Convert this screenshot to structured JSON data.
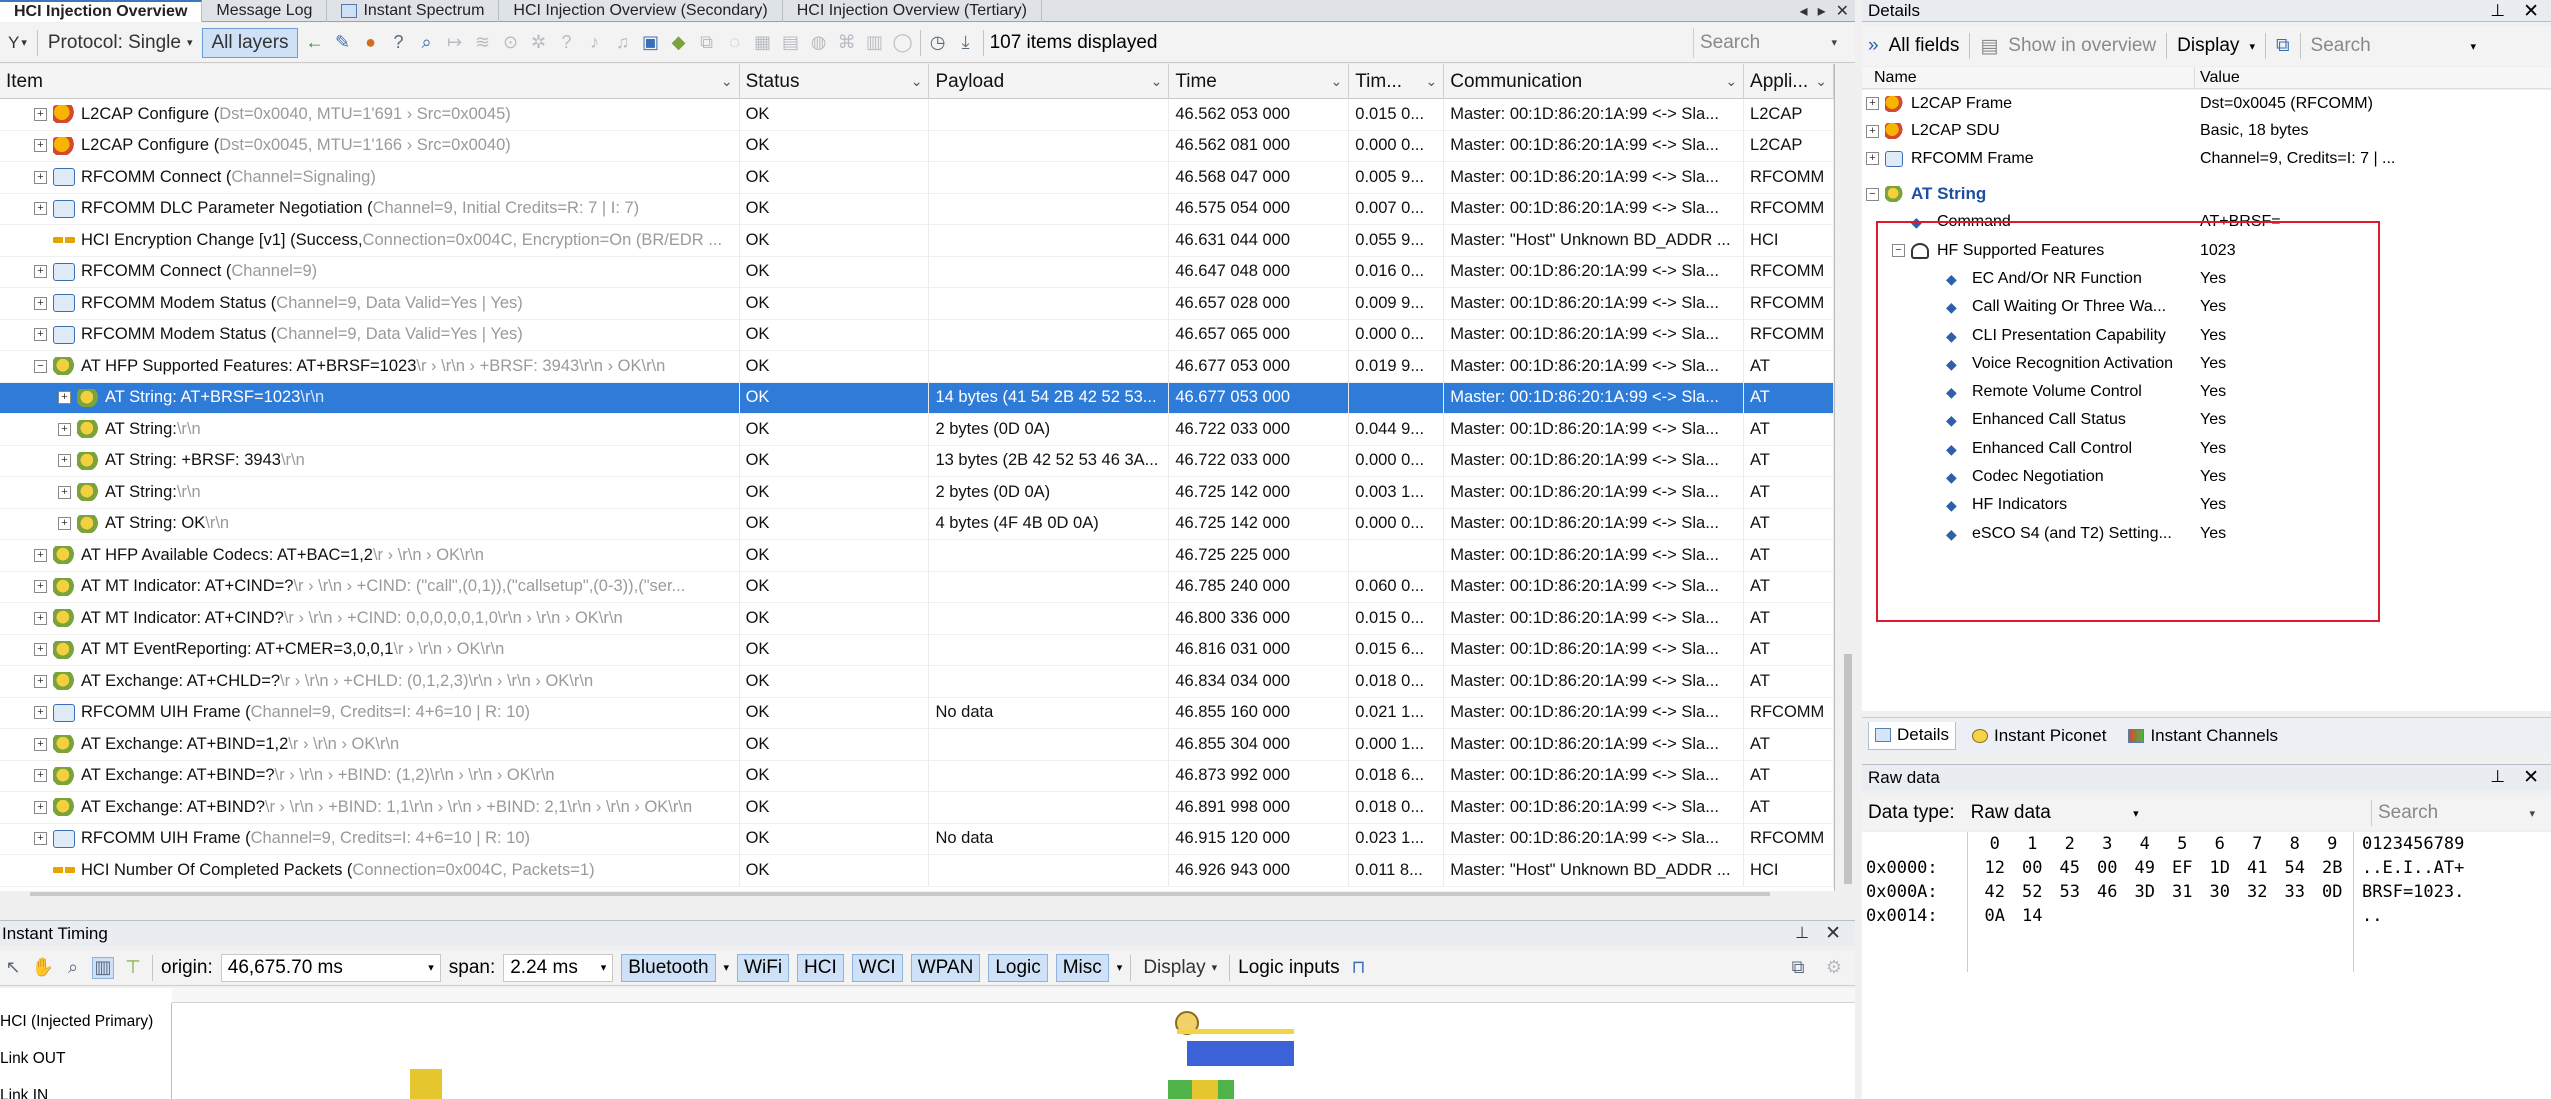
{
  "tabs": [
    {
      "label": "HCI Injection Overview",
      "active": true
    },
    {
      "label": "Message Log",
      "active": false
    },
    {
      "label": "Instant Spectrum",
      "active": false
    },
    {
      "label": "HCI Injection Overview (Secondary)",
      "active": false
    },
    {
      "label": "HCI Injection Overview (Tertiary)",
      "active": false
    }
  ],
  "toolbar": {
    "protocol_label": "Protocol: Single",
    "all_layers_label": "All layers",
    "items_count": "107 items displayed",
    "search_placeholder": "Search"
  },
  "grid": {
    "columns": [
      "Item",
      "Status",
      "Payload",
      "Time",
      "Tim...",
      "Communication",
      "Appli..."
    ],
    "rows": [
      {
        "icon": "l2cap",
        "exp": "+",
        "indent": 0,
        "item": "L2CAP Configure (",
        "params": "Dst=0x0040, MTU=1'691 › Src=0x0045",
        "tail": ")",
        "status": "OK",
        "payload": "",
        "time": "46.562 053 000",
        "delta": "0.015 0...",
        "comm": "Master: 00:1D:86:20:1A:99 <-> Sla...",
        "app": "L2CAP"
      },
      {
        "icon": "l2cap",
        "exp": "+",
        "indent": 0,
        "item": "L2CAP Configure (",
        "params": "Dst=0x0045, MTU=1'166 › Src=0x0040",
        "tail": ")",
        "status": "OK",
        "payload": "",
        "time": "46.562 081 000",
        "delta": "0.000 0...",
        "comm": "Master: 00:1D:86:20:1A:99 <-> Sla...",
        "app": "L2CAP"
      },
      {
        "icon": "rfcomm",
        "exp": "+",
        "indent": 0,
        "item": "RFCOMM Connect (",
        "params": "Channel=Signaling",
        "tail": ")",
        "status": "OK",
        "payload": "",
        "time": "46.568 047 000",
        "delta": "0.005 9...",
        "comm": "Master: 00:1D:86:20:1A:99 <-> Sla...",
        "app": "RFCOMM"
      },
      {
        "icon": "rfcomm",
        "exp": "+",
        "indent": 0,
        "item": "RFCOMM DLC Parameter Negotiation (",
        "params": "Channel=9, Initial Credits=R: 7 | I: 7",
        "tail": ")",
        "status": "OK",
        "payload": "",
        "time": "46.575 054 000",
        "delta": "0.007 0...",
        "comm": "Master: 00:1D:86:20:1A:99 <-> Sla...",
        "app": "RFCOMM"
      },
      {
        "icon": "hci",
        "exp": "",
        "indent": 0,
        "item": "HCI Encryption Change [v1] (Success, ",
        "params": "Connection=0x004C, Encryption=On (BR/EDR ...",
        "tail": "",
        "status": "OK",
        "payload": "",
        "time": "46.631 044 000",
        "delta": "0.055 9...",
        "comm": "Master: \"Host\" Unknown BD_ADDR ...",
        "app": "HCI"
      },
      {
        "icon": "rfcomm",
        "exp": "+",
        "indent": 0,
        "item": "RFCOMM Connect (",
        "params": "Channel=9",
        "tail": ")",
        "status": "OK",
        "payload": "",
        "time": "46.647 048 000",
        "delta": "0.016 0...",
        "comm": "Master: 00:1D:86:20:1A:99 <-> Sla...",
        "app": "RFCOMM"
      },
      {
        "icon": "rfcomm",
        "exp": "+",
        "indent": 0,
        "item": "RFCOMM Modem Status (",
        "params": "Channel=9, Data Valid=Yes | Yes",
        "tail": ")",
        "status": "OK",
        "payload": "",
        "time": "46.657 028 000",
        "delta": "0.009 9...",
        "comm": "Master: 00:1D:86:20:1A:99 <-> Sla...",
        "app": "RFCOMM"
      },
      {
        "icon": "rfcomm",
        "exp": "+",
        "indent": 0,
        "item": "RFCOMM Modem Status (",
        "params": "Channel=9, Data Valid=Yes | Yes",
        "tail": ")",
        "status": "OK",
        "payload": "",
        "time": "46.657 065 000",
        "delta": "0.000 0...",
        "comm": "Master: 00:1D:86:20:1A:99 <-> Sla...",
        "app": "RFCOMM"
      },
      {
        "icon": "at",
        "exp": "−",
        "indent": 0,
        "item": "AT HFP Supported Features: AT+BRSF=1023",
        "params": "\\r › \\r\\n › +BRSF: 3943",
        "tail": "\\r\\n › OK\\r\\n",
        "status": "OK",
        "payload": "",
        "time": "46.677 053 000",
        "delta": "0.019 9...",
        "comm": "Master: 00:1D:86:20:1A:99 <-> Sla...",
        "app": "AT"
      },
      {
        "icon": "at",
        "exp": "+",
        "indent": 1,
        "item": "AT String: AT+BRSF=1023",
        "params": "\\r\\n",
        "tail": "",
        "status": "OK",
        "payload": "14 bytes (41 54 2B 42 52 53...",
        "time": "46.677 053 000",
        "delta": "",
        "comm": "Master: 00:1D:86:20:1A:99 <-> Sla...",
        "app": "AT",
        "selected": true
      },
      {
        "icon": "at",
        "exp": "+",
        "indent": 1,
        "item": "AT String: ",
        "params": "\\r\\n",
        "tail": "",
        "status": "OK",
        "payload": "2 bytes (0D 0A)",
        "time": "46.722 033 000",
        "delta": "0.044 9...",
        "comm": "Master: 00:1D:86:20:1A:99 <-> Sla...",
        "app": "AT"
      },
      {
        "icon": "at",
        "exp": "+",
        "indent": 1,
        "item": "AT String: +BRSF: 3943",
        "params": "\\r\\n",
        "tail": "",
        "status": "OK",
        "payload": "13 bytes (2B 42 52 53 46 3A...",
        "time": "46.722 033 000",
        "delta": "0.000 0...",
        "comm": "Master: 00:1D:86:20:1A:99 <-> Sla...",
        "app": "AT"
      },
      {
        "icon": "at",
        "exp": "+",
        "indent": 1,
        "item": "AT String: ",
        "params": "\\r\\n",
        "tail": "",
        "status": "OK",
        "payload": "2 bytes (0D 0A)",
        "time": "46.725 142 000",
        "delta": "0.003 1...",
        "comm": "Master: 00:1D:86:20:1A:99 <-> Sla...",
        "app": "AT"
      },
      {
        "icon": "at",
        "exp": "+",
        "indent": 1,
        "item": "AT String: OK",
        "params": "\\r\\n",
        "tail": "",
        "status": "OK",
        "payload": "4 bytes (4F 4B 0D 0A)",
        "time": "46.725 142 000",
        "delta": "0.000 0...",
        "comm": "Master: 00:1D:86:20:1A:99 <-> Sla...",
        "app": "AT"
      },
      {
        "icon": "at",
        "exp": "+",
        "indent": 0,
        "item": "AT HFP Available Codecs: AT+BAC=1,2",
        "params": "\\r › \\r\\n › OK\\r\\n",
        "tail": "",
        "status": "OK",
        "payload": "",
        "time": "46.725 225 000",
        "delta": "",
        "comm": "Master: 00:1D:86:20:1A:99 <-> Sla...",
        "app": "AT"
      },
      {
        "icon": "at",
        "exp": "+",
        "indent": 0,
        "item": "AT MT Indicator: AT+CIND=?",
        "params": "\\r › \\r\\n › +CIND: (\"call\",(0,1)),(\"callsetup\",(0-3)),(\"ser...",
        "tail": "",
        "status": "OK",
        "payload": "",
        "time": "46.785 240 000",
        "delta": "0.060 0...",
        "comm": "Master: 00:1D:86:20:1A:99 <-> Sla...",
        "app": "AT"
      },
      {
        "icon": "at",
        "exp": "+",
        "indent": 0,
        "item": "AT MT Indicator: AT+CIND?",
        "params": "\\r › \\r\\n › +CIND: 0,0,0,0,0,1,0\\r\\n › \\r\\n › OK\\r\\n",
        "tail": "",
        "status": "OK",
        "payload": "",
        "time": "46.800 336 000",
        "delta": "0.015 0...",
        "comm": "Master: 00:1D:86:20:1A:99 <-> Sla...",
        "app": "AT"
      },
      {
        "icon": "at",
        "exp": "+",
        "indent": 0,
        "item": "AT MT EventReporting: AT+CMER=3,0,0,1",
        "params": "\\r › \\r\\n › OK\\r\\n",
        "tail": "",
        "status": "OK",
        "payload": "",
        "time": "46.816 031 000",
        "delta": "0.015 6...",
        "comm": "Master: 00:1D:86:20:1A:99 <-> Sla...",
        "app": "AT"
      },
      {
        "icon": "at",
        "exp": "+",
        "indent": 0,
        "item": "AT Exchange: AT+CHLD=?",
        "params": "\\r › \\r\\n › +CHLD: (0,1,2,3)\\r\\n › \\r\\n › OK\\r\\n",
        "tail": "",
        "status": "OK",
        "payload": "",
        "time": "46.834 034 000",
        "delta": "0.018 0...",
        "comm": "Master: 00:1D:86:20:1A:99 <-> Sla...",
        "app": "AT"
      },
      {
        "icon": "rfcomm",
        "exp": "+",
        "indent": 0,
        "item": "RFCOMM UIH Frame (",
        "params": "Channel=9, Credits=I: 4+6=10 | R: 10",
        "tail": ")",
        "status": "OK",
        "payload": "No data",
        "time": "46.855 160 000",
        "delta": "0.021 1...",
        "comm": "Master: 00:1D:86:20:1A:99 <-> Sla...",
        "app": "RFCOMM"
      },
      {
        "icon": "at",
        "exp": "+",
        "indent": 0,
        "item": "AT Exchange: AT+BIND=1,2",
        "params": "\\r › \\r\\n › OK\\r\\n",
        "tail": "",
        "status": "OK",
        "payload": "",
        "time": "46.855 304 000",
        "delta": "0.000 1...",
        "comm": "Master: 00:1D:86:20:1A:99 <-> Sla...",
        "app": "AT"
      },
      {
        "icon": "at",
        "exp": "+",
        "indent": 0,
        "item": "AT Exchange: AT+BIND=?",
        "params": "\\r › \\r\\n › +BIND: (1,2)\\r\\n › \\r\\n › OK\\r\\n",
        "tail": "",
        "status": "OK",
        "payload": "",
        "time": "46.873 992 000",
        "delta": "0.018 6...",
        "comm": "Master: 00:1D:86:20:1A:99 <-> Sla...",
        "app": "AT"
      },
      {
        "icon": "at",
        "exp": "+",
        "indent": 0,
        "item": "AT Exchange: AT+BIND?",
        "params": "\\r › \\r\\n › +BIND: 1,1\\r\\n › \\r\\n › +BIND: 2,1\\r\\n › \\r\\n › OK\\r\\n",
        "tail": "",
        "status": "OK",
        "payload": "",
        "time": "46.891 998 000",
        "delta": "0.018 0...",
        "comm": "Master: 00:1D:86:20:1A:99 <-> Sla...",
        "app": "AT"
      },
      {
        "icon": "rfcomm",
        "exp": "+",
        "indent": 0,
        "item": "RFCOMM UIH Frame (",
        "params": "Channel=9, Credits=I: 4+6=10 | R: 10",
        "tail": ")",
        "status": "OK",
        "payload": "No data",
        "time": "46.915 120 000",
        "delta": "0.023 1...",
        "comm": "Master: 00:1D:86:20:1A:99 <-> Sla...",
        "app": "RFCOMM"
      },
      {
        "icon": "hci",
        "exp": "",
        "indent": 0,
        "item": "HCI Number Of Completed Packets (",
        "params": "Connection=0x004C, Packets=1",
        "tail": ")",
        "status": "OK",
        "payload": "",
        "time": "46.926 943 000",
        "delta": "0.011 8...",
        "comm": "Master: \"Host\" Unknown BD_ADDR ...",
        "app": "HCI"
      }
    ]
  },
  "timing": {
    "title": "Instant Timing",
    "origin_label": "origin:",
    "origin_value": "46,675.70 ms",
    "span_label": "span:",
    "span_value": "2.24 ms",
    "filters": [
      "Bluetooth",
      "WiFi",
      "HCI",
      "WCI",
      "WPAN",
      "Logic",
      "Misc"
    ],
    "display_label": "Display",
    "logic_inputs_label": "Logic inputs",
    "lanes": [
      "HCI (Injected Primary)",
      "Link OUT",
      "Link IN"
    ]
  },
  "details": {
    "title": "Details",
    "all_fields": "All fields",
    "show_overview": "Show in overview",
    "display": "Display",
    "search_placeholder": "Search",
    "col_name": "Name",
    "col_value": "Value",
    "rows": [
      {
        "name": "L2CAP Frame",
        "value": "Dst=0x0045 (RFCOMM)",
        "icon": "l2cap",
        "exp": "+",
        "level": 0
      },
      {
        "name": "L2CAP SDU",
        "value": "Basic, 18 bytes",
        "icon": "l2cap",
        "exp": "+",
        "level": 0
      },
      {
        "name": "RFCOMM Frame",
        "value": "Channel=9, Credits=I: 7 | ...",
        "icon": "rfcomm",
        "exp": "+",
        "level": 0
      },
      {
        "name": "AT String",
        "value": "",
        "icon": "at",
        "exp": "−",
        "level": 0,
        "bold": true
      },
      {
        "name": "Command",
        "value": "AT+BRSF=",
        "icon": "pin",
        "exp": "",
        "level": 1
      },
      {
        "name": "HF Supported Features",
        "value": "1023",
        "icon": "headset",
        "exp": "−",
        "level": 1
      },
      {
        "name": "EC And/Or NR Function",
        "value": "Yes",
        "icon": "pin",
        "exp": "",
        "level": 2
      },
      {
        "name": "Call Waiting Or Three Wa...",
        "value": "Yes",
        "icon": "pin",
        "exp": "",
        "level": 2
      },
      {
        "name": "CLI Presentation Capability",
        "value": "Yes",
        "icon": "pin",
        "exp": "",
        "level": 2
      },
      {
        "name": "Voice Recognition Activation",
        "value": "Yes",
        "icon": "pin",
        "exp": "",
        "level": 2
      },
      {
        "name": "Remote Volume Control",
        "value": "Yes",
        "icon": "pin",
        "exp": "",
        "level": 2
      },
      {
        "name": "Enhanced Call Status",
        "value": "Yes",
        "icon": "pin",
        "exp": "",
        "level": 2
      },
      {
        "name": "Enhanced Call Control",
        "value": "Yes",
        "icon": "pin",
        "exp": "",
        "level": 2
      },
      {
        "name": "Codec Negotiation",
        "value": "Yes",
        "icon": "pin",
        "exp": "",
        "level": 2
      },
      {
        "name": "HF Indicators",
        "value": "Yes",
        "icon": "pin",
        "exp": "",
        "level": 2
      },
      {
        "name": "eSCO S4 (and T2) Setting...",
        "value": "Yes",
        "icon": "pin",
        "exp": "",
        "level": 2
      }
    ],
    "tabs": [
      "Details",
      "Instant Piconet",
      "Instant Channels"
    ]
  },
  "raw": {
    "title": "Raw data",
    "data_type_label": "Data type:",
    "data_type_value": "Raw data",
    "search_placeholder": "Search",
    "column_indices": [
      "0",
      "1",
      "2",
      "3",
      "4",
      "5",
      "6",
      "7",
      "8",
      "9"
    ],
    "ascii_header": "0123456789",
    "lines": [
      {
        "addr": "0x0000:",
        "bytes": [
          "12",
          "00",
          "45",
          "00",
          "49",
          "EF",
          "1D",
          "41",
          "54",
          "2B"
        ],
        "ascii": "..E.I..AT+"
      },
      {
        "addr": "0x000A:",
        "bytes": [
          "42",
          "52",
          "53",
          "46",
          "3D",
          "31",
          "30",
          "32",
          "33",
          "0D"
        ],
        "ascii": "BRSF=1023."
      },
      {
        "addr": "0x0014:",
        "bytes": [
          "0A",
          "14"
        ],
        "ascii": ".."
      }
    ]
  },
  "colors": {
    "selection": "#2f7bd8",
    "highlight_box": "#e0182b",
    "toggle_bg": "#cfe1f7"
  }
}
